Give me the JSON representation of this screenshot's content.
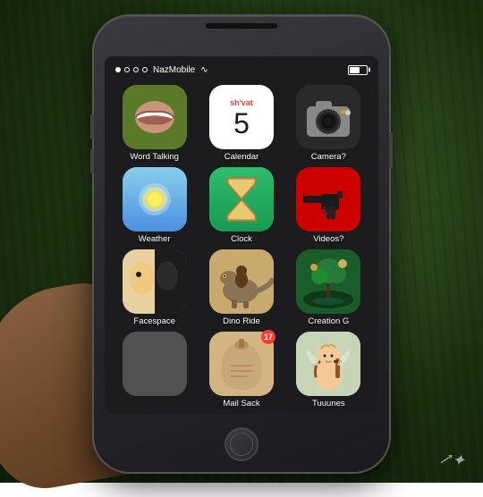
{
  "background": {
    "color1": "#4a6741",
    "color2": "#1a2e10"
  },
  "phone": {
    "status_bar": {
      "signal_dots": [
        "filled",
        "empty",
        "empty",
        "empty"
      ],
      "carrier": "NazMobile",
      "wifi": "wifi",
      "battery_percent": 60
    },
    "apps": [
      {
        "id": "word-talking",
        "label": "Word Talking",
        "icon_type": "word-talking",
        "badge": null
      },
      {
        "id": "calendar",
        "label": "Calendar",
        "icon_type": "calendar",
        "cal_day": "5",
        "cal_month": "sh'vat",
        "badge": null
      },
      {
        "id": "camera",
        "label": "Camera?",
        "icon_type": "camera",
        "badge": null
      },
      {
        "id": "weather",
        "label": "Weather",
        "icon_type": "weather",
        "badge": null
      },
      {
        "id": "clock",
        "label": "Clock",
        "icon_type": "clock",
        "badge": null
      },
      {
        "id": "videos",
        "label": "Videos?",
        "icon_type": "videos",
        "badge": null
      },
      {
        "id": "facespace",
        "label": "Facespace",
        "icon_type": "facespace",
        "badge": null
      },
      {
        "id": "dino-ride",
        "label": "Dino Ride",
        "icon_type": "dino",
        "badge": null
      },
      {
        "id": "creation-g",
        "label": "Creation G",
        "icon_type": "creation",
        "badge": null
      },
      {
        "id": "partial",
        "label": "",
        "icon_type": "partial",
        "badge": null,
        "partially_hidden": true
      },
      {
        "id": "mail-sack",
        "label": "Mail Sack",
        "icon_type": "mailsack",
        "badge": "17"
      },
      {
        "id": "tuuunes",
        "label": "Tuuunes",
        "icon_type": "tuuunes",
        "badge": null
      }
    ]
  },
  "watermark": "↗"
}
